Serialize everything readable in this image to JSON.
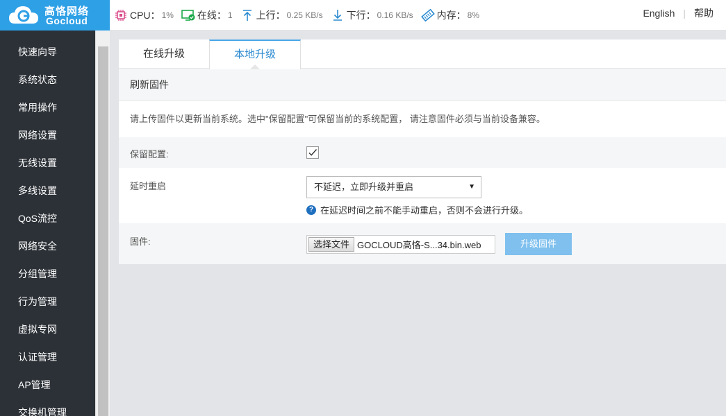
{
  "brand": {
    "name_cn": "高恪网络",
    "name_en": "Gocloud",
    "color": "#2ea0e6"
  },
  "status_bar": {
    "cpu": {
      "label": "CPU：",
      "value": "1%"
    },
    "online": {
      "label": "在线：",
      "value": "1"
    },
    "upload": {
      "label": "上行：",
      "value": "0.25 KB/s"
    },
    "download": {
      "label": "下行：",
      "value": "0.16 KB/s"
    },
    "memory": {
      "label": "内存：",
      "value": "8%"
    }
  },
  "header_links": {
    "language": "English",
    "help": "帮助"
  },
  "sidebar": {
    "items": [
      {
        "label": "快速向导"
      },
      {
        "label": "系统状态"
      },
      {
        "label": "常用操作"
      },
      {
        "label": "网络设置"
      },
      {
        "label": "无线设置"
      },
      {
        "label": "多线设置"
      },
      {
        "label": "QoS流控"
      },
      {
        "label": "网络安全"
      },
      {
        "label": "分组管理"
      },
      {
        "label": "行为管理"
      },
      {
        "label": "虚拟专网"
      },
      {
        "label": "认证管理"
      },
      {
        "label": "AP管理"
      },
      {
        "label": "交换机管理"
      }
    ]
  },
  "tabs": [
    {
      "label": "在线升级",
      "active": false
    },
    {
      "label": "本地升级",
      "active": true
    }
  ],
  "section": {
    "title": "刷新固件",
    "description": "请上传固件以更新当前系统。选中\"保留配置\"可保留当前的系统配置， 请注意固件必须与当前设备兼容。"
  },
  "form": {
    "keep_config": {
      "label": "保留配置:",
      "checked": true
    },
    "delay_reboot": {
      "label": "延时重启",
      "selected": "不延迟，立即升级并重启",
      "hint": "在延迟时间之前不能手动重启，否则不会进行升级。"
    },
    "firmware": {
      "label": "固件:",
      "choose_button": "选择文件",
      "file_name": "GOCLOUD高恪-S...34.bin.web",
      "upgrade_button": "升级固件"
    }
  },
  "colors": {
    "accent": "#2b8ad0",
    "sidebar_bg": "#2c3137",
    "upgrade_button": "#7fc0ee"
  }
}
